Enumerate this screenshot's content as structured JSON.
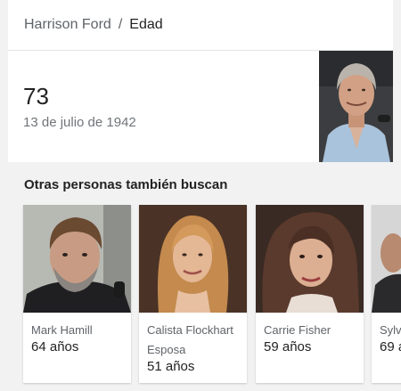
{
  "breadcrumb": {
    "parent": "Harrison Ford",
    "separator": "/",
    "current": "Edad"
  },
  "answer": {
    "age": "73",
    "birth_date": "13 de julio de 1942"
  },
  "related": {
    "title": "Otras personas también buscan",
    "people": [
      {
        "name": "Mark Hamill",
        "relation": "",
        "age": "64 años"
      },
      {
        "name": "Calista Flockhart",
        "relation": "Esposa",
        "age": "51 años"
      },
      {
        "name": "Carrie Fisher",
        "relation": "",
        "age": "59 años"
      },
      {
        "name": "Sylv",
        "relation": "",
        "age": "69 a"
      }
    ]
  },
  "colors": {
    "background": "#f2f2f2",
    "card": "#ffffff",
    "primary_text": "#222222",
    "secondary_text": "#5f6368"
  }
}
